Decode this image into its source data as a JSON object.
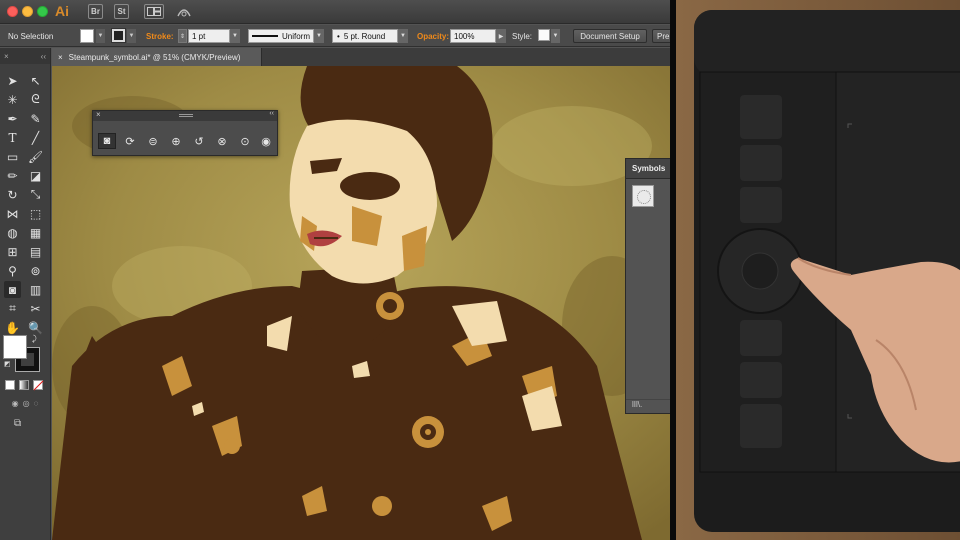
{
  "window": {
    "app_logo": "Ai",
    "bridge_label": "Br",
    "stock_label": "St",
    "arrange_icon": "arrange-documents-icon",
    "gpu_icon": "gpu-performance-icon"
  },
  "control_bar": {
    "selection": "No Selection",
    "stroke_label": "Stroke:",
    "stroke_weight": "1 pt",
    "profile": "Uniform",
    "brush": "5 pt. Round",
    "opacity_label": "Opacity:",
    "opacity_value": "100%",
    "style_label": "Style:",
    "document_setup": "Document Setup",
    "preferences": "Pre"
  },
  "document": {
    "tab_title": "Steampunk_symbol.ai* @ 51% (CMYK/Preview)",
    "close_icon": "×"
  },
  "toolbox": {
    "collapse": "‹‹",
    "close": "×"
  },
  "symbol_sprayer_panel": {
    "close": "×",
    "collapse": "‹‹",
    "tools": [
      "symbol-sprayer-icon",
      "symbol-shifter-icon",
      "symbol-scruncher-icon",
      "symbol-sizer-icon",
      "symbol-spinner-icon",
      "symbol-stainer-icon",
      "symbol-screener-icon",
      "symbol-styler-icon"
    ]
  },
  "symbols_panel": {
    "tab": "Symbols",
    "footer": "lIl\\."
  },
  "colors": {
    "accent_orange": "#f08a1a",
    "art_dark_brown": "#4a2a12",
    "art_tan": "#c8a060",
    "art_cream": "#f3dcae",
    "art_olive_bg": "#a08e45",
    "tablet_body": "#1c1c1c"
  }
}
